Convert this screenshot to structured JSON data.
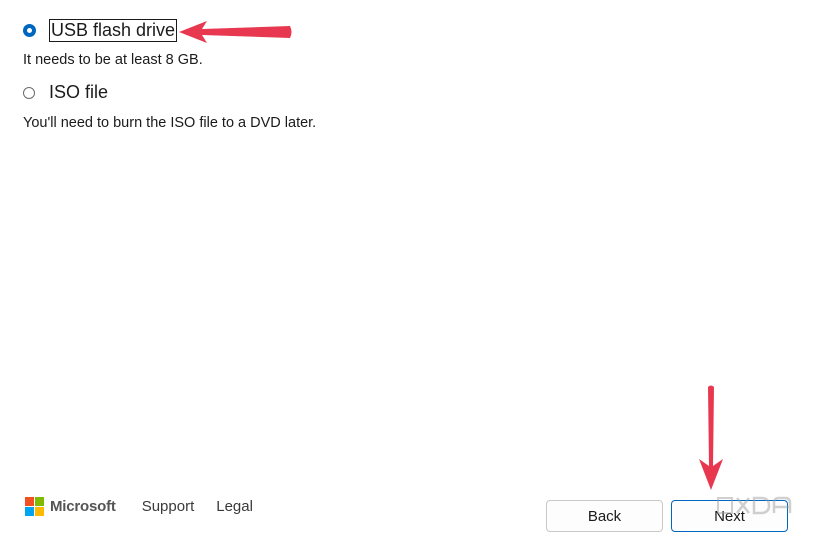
{
  "options": [
    {
      "label": "USB flash drive",
      "description": "It needs to be at least 8 GB.",
      "selected": true
    },
    {
      "label": "ISO file",
      "description": "You'll need to burn the ISO file to a DVD later.",
      "selected": false
    }
  ],
  "footer": {
    "brand": "Microsoft",
    "links": [
      "Support",
      "Legal"
    ],
    "logo_colors": [
      "#f25022",
      "#7fba00",
      "#00a4ef",
      "#ffb900"
    ]
  },
  "buttons": {
    "back_label": "Back",
    "next_label": "Next"
  },
  "watermark": {
    "text": "XDA"
  },
  "colors": {
    "accent": "#0067c0",
    "annotation_arrow": "#e8384f"
  }
}
